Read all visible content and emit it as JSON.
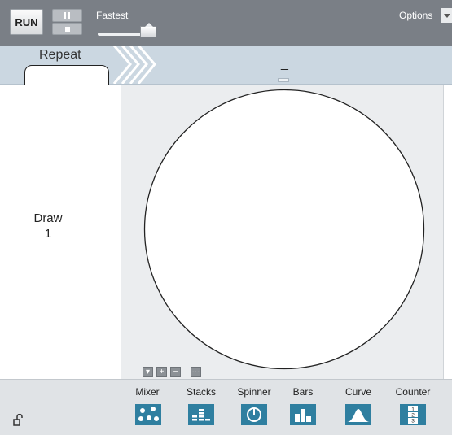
{
  "toolbar": {
    "run_label": "RUN",
    "speed_label": "Fastest",
    "speed_level": 1.0,
    "options_label": "Options"
  },
  "repeat": {
    "label": "Repeat",
    "value": "",
    "center_label": "_"
  },
  "draw": {
    "label": "Draw",
    "count": "1"
  },
  "canvas_controls": [
    "▾",
    "+",
    "−",
    "···"
  ],
  "tools": [
    {
      "label": "Mixer",
      "icon": "mixer-icon"
    },
    {
      "label": "Stacks",
      "icon": "stacks-icon"
    },
    {
      "label": "Spinner",
      "icon": "spinner-icon"
    },
    {
      "label": "Bars",
      "icon": "bars-icon"
    },
    {
      "label": "Curve",
      "icon": "curve-icon"
    },
    {
      "label": "Counter",
      "icon": "counter-icon"
    }
  ],
  "counter_icon_digits": [
    "1",
    "2",
    "3"
  ],
  "colors": {
    "toolbar_bg": "#7a7f86",
    "repeat_bar_bg": "#cbd7e1",
    "canvas_bg": "#ebedef",
    "tool_icon": "#2f7fa0"
  }
}
